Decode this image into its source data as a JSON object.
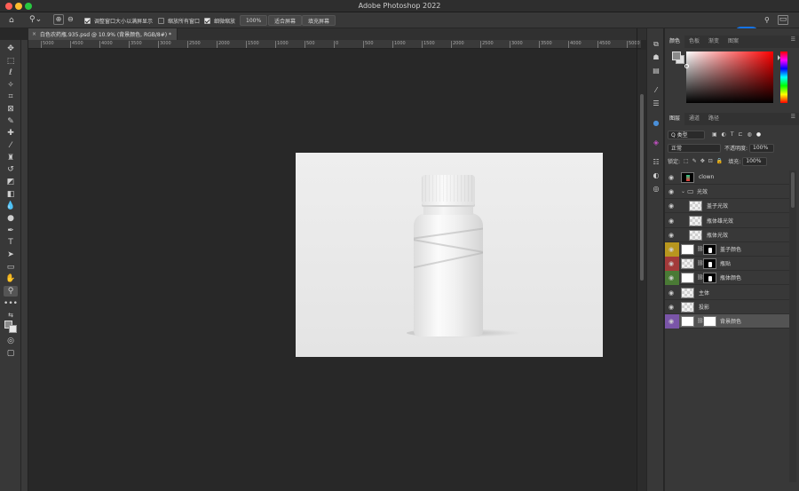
{
  "app": {
    "title": "Adobe Photoshop 2022"
  },
  "options_bar": {
    "resize_windows_label": "调整窗口大小以满屏显示",
    "zoom_all_windows_label": "缩放所有窗口",
    "scrubby_zoom_label": "细微缩放",
    "zoom_value": "100%",
    "fit_screen_button": "适合屏幕",
    "fill_screen_button": "填充屏幕",
    "share_button": "共享"
  },
  "document_tab": {
    "close": "×",
    "label": "白色农药瓶.935.psd @ 10.9% (背景颜色, RGB/8#) *"
  },
  "ruler": {
    "top_ticks": [
      "5000",
      "4500",
      "4000",
      "3500",
      "3000",
      "2500",
      "2000",
      "1500",
      "1000",
      "500",
      "0",
      "500",
      "1000",
      "1500",
      "2000",
      "2500",
      "3000",
      "3500",
      "4000",
      "4500",
      "5000",
      "5500",
      "6000",
      "6500",
      "7000",
      "7500",
      "8000",
      "8500",
      "9000",
      "9500",
      "10000",
      "10500",
      "11000"
    ]
  },
  "color_panel": {
    "tabs": [
      "颜色",
      "色板",
      "渐变",
      "图案"
    ],
    "active": "颜色"
  },
  "layers_panel": {
    "tabs": [
      "图层",
      "通道",
      "路径"
    ],
    "active": "图层",
    "filter_label": "Q 类型",
    "blend_mode": "正常",
    "opacity_label": "不透明度:",
    "opacity_value": "100%",
    "lock_label": "锁定:",
    "fill_label": "填充:",
    "fill_value": "100%",
    "layers": [
      {
        "name": "clown",
        "type": "smart",
        "color": ""
      },
      {
        "name": "光效",
        "type": "group",
        "color": ""
      },
      {
        "name": "盖子光效",
        "type": "layer-indent",
        "color": ""
      },
      {
        "name": "瓶体雄光效",
        "type": "layer-indent",
        "color": ""
      },
      {
        "name": "瓶体光效",
        "type": "layer-indent",
        "color": ""
      },
      {
        "name": "盖子颜色",
        "type": "fill-mask",
        "color": "#b8961e"
      },
      {
        "name": "瓶贴",
        "type": "smart-mask",
        "color": "#a33a3a"
      },
      {
        "name": "瓶体颜色",
        "type": "fill-mask",
        "color": "#4a7a35"
      },
      {
        "name": "主体",
        "type": "pixel",
        "color": ""
      },
      {
        "name": "投影",
        "type": "pixel",
        "color": ""
      },
      {
        "name": "背景颜色",
        "type": "fill-white",
        "color": "#7a55a8"
      }
    ]
  },
  "colors": {
    "accent": "#1473e6",
    "canvas_bg": "#282828",
    "panel_bg": "#383838"
  }
}
